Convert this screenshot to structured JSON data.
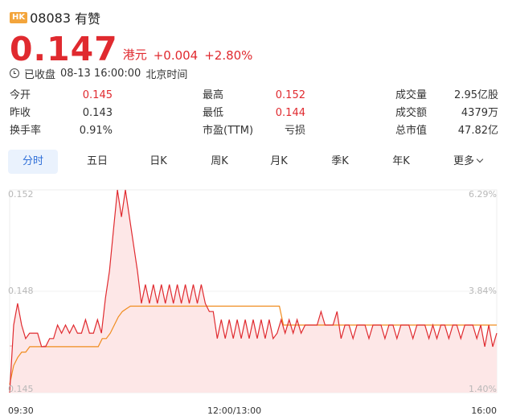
{
  "header": {
    "market_badge": "HK",
    "code": "08083",
    "name": "有赞"
  },
  "quote": {
    "price": "0.147",
    "currency": "港元",
    "change": "+0.004",
    "change_pct": "+2.80%",
    "status": "已收盘",
    "datetime": "08-13 16:00:00",
    "timezone": "北京时间"
  },
  "stats": [
    {
      "label": "今开",
      "value": "0.145",
      "color": "#e02a2f"
    },
    {
      "label": "最高",
      "value": "0.152",
      "color": "#e02a2f"
    },
    {
      "label": "成交量",
      "value": "2.95亿股",
      "color": "#333333"
    },
    {
      "label": "昨收",
      "value": "0.143",
      "color": "#333333"
    },
    {
      "label": "最低",
      "value": "0.144",
      "color": "#e02a2f"
    },
    {
      "label": "成交额",
      "value": "4379万",
      "color": "#333333"
    },
    {
      "label": "换手率",
      "value": "0.91%",
      "color": "#333333"
    },
    {
      "label": "市盈(TTM)",
      "value": "亏损",
      "color": "#333333"
    },
    {
      "label": "总市值",
      "value": "47.82亿",
      "color": "#333333"
    }
  ],
  "tabs": [
    {
      "label": "分时",
      "active": true
    },
    {
      "label": "五日"
    },
    {
      "label": "日K"
    },
    {
      "label": "周K"
    },
    {
      "label": "月K"
    },
    {
      "label": "季K"
    },
    {
      "label": "年K"
    },
    {
      "label": "更多"
    }
  ],
  "colors": {
    "up": "#e02a2f",
    "accent": "#2f6fd8",
    "badge": "#f3a53c",
    "avg_line": "#f08c1e"
  },
  "chart_data": {
    "type": "line",
    "y_ticks_left": [
      "0.152",
      "0.148",
      "0.145"
    ],
    "y_ticks_right": [
      "6.29%",
      "3.84%",
      "1.40%"
    ],
    "x_ticks": [
      "09:30",
      "12:00/13:00",
      "16:00"
    ],
    "ylim": [
      0.1445,
      0.152
    ],
    "prev_close": 0.143,
    "series": [
      {
        "values": [
          0.1445,
          0.147,
          0.1478,
          0.147,
          0.1465,
          0.1467,
          0.1467,
          0.1467,
          0.1462,
          0.1462,
          0.1465,
          0.1465,
          0.147,
          0.1467,
          0.147,
          0.1467,
          0.147,
          0.1467,
          0.1467,
          0.1472,
          0.1467,
          0.1467,
          0.1472,
          0.1467,
          0.148,
          0.149,
          0.1505,
          0.152,
          0.151,
          0.152,
          0.151,
          0.15,
          0.149,
          0.1478,
          0.1485,
          0.1478,
          0.1485,
          0.1478,
          0.1485,
          0.1478,
          0.1485,
          0.1478,
          0.1485,
          0.1478,
          0.1485,
          0.1478,
          0.1485,
          0.1478,
          0.1485,
          0.1478,
          0.1475,
          0.1475,
          0.1465,
          0.1472,
          0.1465,
          0.1472,
          0.1465,
          0.1472,
          0.1465,
          0.1472,
          0.1465,
          0.1472,
          0.1465,
          0.1472,
          0.1465,
          0.1472,
          0.1465,
          0.1467,
          0.1472,
          0.1467,
          0.1472,
          0.1467,
          0.1472,
          0.1467,
          0.147,
          0.147,
          0.147,
          0.147,
          0.1475,
          0.147,
          0.147,
          0.147,
          0.1475,
          0.1465,
          0.147,
          0.147,
          0.1465,
          0.147,
          0.147,
          0.147,
          0.1465,
          0.147,
          0.147,
          0.147,
          0.1465,
          0.147,
          0.147,
          0.1465,
          0.147,
          0.147,
          0.147,
          0.1465,
          0.147,
          0.147,
          0.147,
          0.1465,
          0.147,
          0.1465,
          0.147,
          0.147,
          0.1465,
          0.147,
          0.147,
          0.1465,
          0.147,
          0.147,
          0.147,
          0.1465,
          0.147,
          0.1462,
          0.147,
          0.1462,
          0.1467
        ],
        "color": "#e02a2f"
      },
      {
        "values": [
          0.1448,
          0.1455,
          0.1458,
          0.146,
          0.146,
          0.1462,
          0.1462,
          0.1462,
          0.1462,
          0.1462,
          0.1462,
          0.1462,
          0.1462,
          0.1462,
          0.1462,
          0.1462,
          0.1462,
          0.1462,
          0.1462,
          0.1462,
          0.1462,
          0.1462,
          0.1462,
          0.1465,
          0.1465,
          0.1467,
          0.147,
          0.1473,
          0.1475,
          0.1476,
          0.1477,
          0.1477,
          0.1477,
          0.1477,
          0.1477,
          0.1477,
          0.1477,
          0.1477,
          0.1477,
          0.1477,
          0.1477,
          0.1477,
          0.1477,
          0.1477,
          0.1477,
          0.1477,
          0.1477,
          0.1477,
          0.1477,
          0.1477,
          0.1477,
          0.1477,
          0.1477,
          0.1477,
          0.1477,
          0.1477,
          0.1477,
          0.1477,
          0.1477,
          0.1477,
          0.1477,
          0.1477,
          0.1477,
          0.1477,
          0.1477,
          0.1477,
          0.1477,
          0.1477,
          0.147,
          0.147,
          0.147,
          0.147,
          0.147,
          0.147,
          0.147,
          0.147,
          0.147,
          0.147,
          0.147,
          0.147,
          0.147,
          0.147,
          0.147,
          0.147,
          0.147,
          0.147,
          0.147,
          0.147,
          0.147,
          0.147,
          0.147,
          0.147,
          0.147,
          0.147,
          0.147,
          0.147,
          0.147,
          0.147,
          0.147,
          0.147,
          0.147,
          0.147,
          0.147,
          0.147,
          0.147,
          0.147,
          0.147,
          0.147,
          0.147,
          0.147,
          0.147,
          0.147,
          0.147,
          0.147,
          0.147,
          0.147,
          0.147,
          0.147,
          0.147,
          0.147,
          0.147,
          0.147
        ],
        "color": "#f08c1e"
      }
    ]
  }
}
